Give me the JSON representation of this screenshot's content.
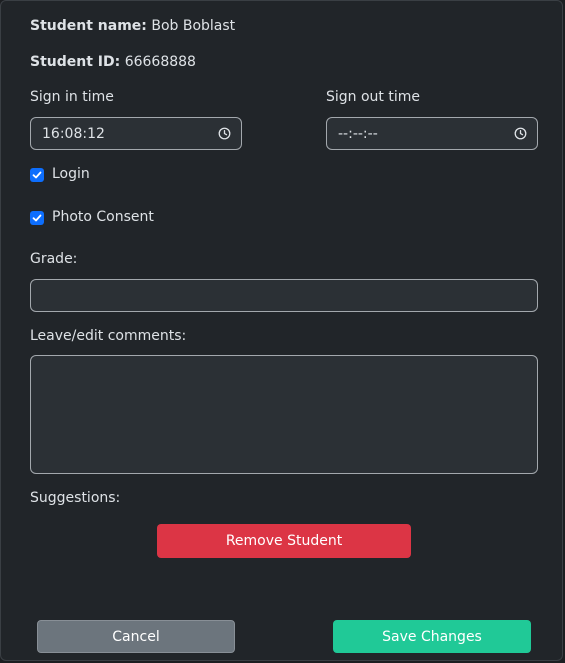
{
  "student": {
    "name_label": "Student name:",
    "name_value": "Bob Boblast",
    "id_label": "Student ID:",
    "id_value": "66668888"
  },
  "sign_in": {
    "label": "Sign in time",
    "value": "16:08:12"
  },
  "sign_out": {
    "label": "Sign out time",
    "value": "--:--:--"
  },
  "login": {
    "label": "Login",
    "checked": true
  },
  "photo_consent": {
    "label": "Photo Consent",
    "checked": true
  },
  "grade": {
    "label": "Grade:",
    "value": ""
  },
  "comments": {
    "label": "Leave/edit comments:",
    "value": ""
  },
  "suggestions": {
    "label": "Suggestions:"
  },
  "buttons": {
    "remove": "Remove Student",
    "cancel": "Cancel",
    "save": "Save Changes"
  },
  "colors": {
    "background": "#212529",
    "checkbox": "#0d6efd",
    "danger": "#dc3545",
    "secondary": "#6c757d",
    "success": "#20c997"
  },
  "icons": {
    "time_picker": "clock-icon",
    "checkbox": "checkmark-icon"
  }
}
